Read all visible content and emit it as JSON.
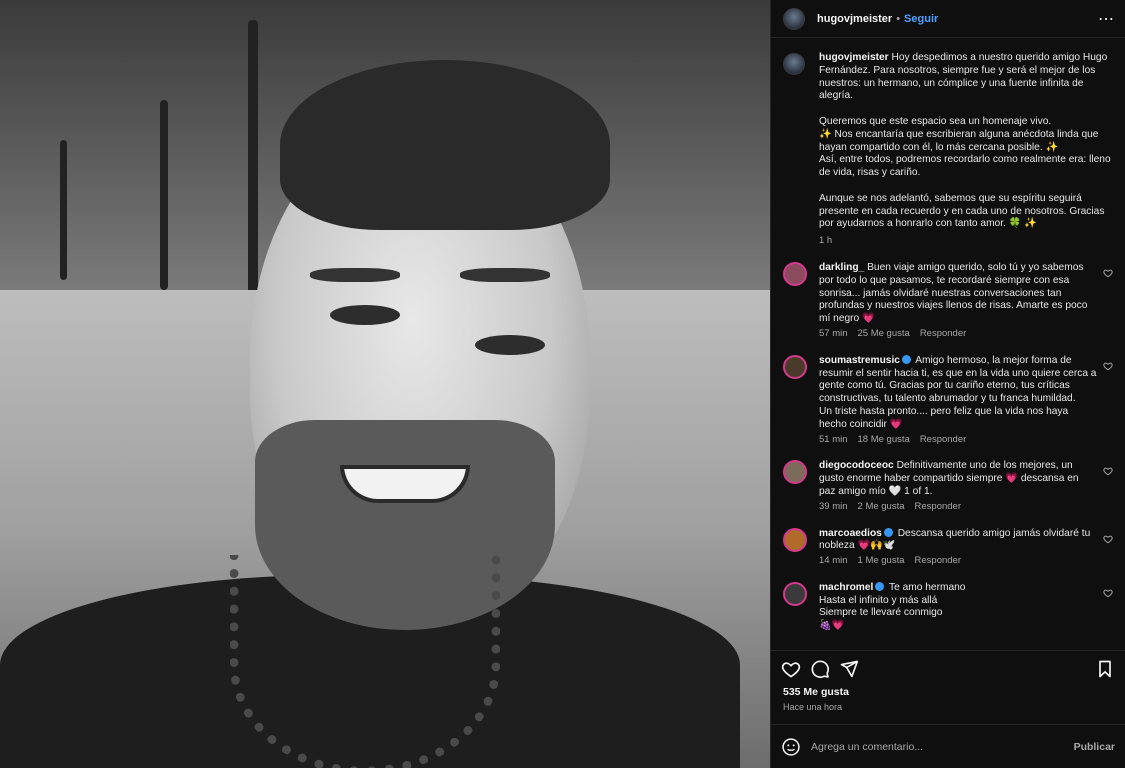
{
  "post": {
    "username": "hugovjmeister",
    "separator": "•",
    "follow_label": "Seguir",
    "more_label": "⋯"
  },
  "caption": {
    "username": "hugovjmeister",
    "paragraphs": [
      "Hoy despedimos a nuestro querido amigo Hugo Fernández. Para nosotros, siempre fue y será el mejor de los nuestros: un hermano, un cómplice y una fuente infinita de alegría.",
      "Queremos que este espacio sea un homenaje vivo.\n✨ Nos encantaría que escribieran alguna anécdota linda que hayan compartido con él, lo más cercana posible. ✨\nAsí, entre todos, podremos recordarlo como realmente era: lleno de vida, risas y cariño.",
      "Aunque se nos adelantó, sabemos que su espíritu seguirá presente en cada recuerdo y en cada uno de nosotros. Gracias por ayudarnos a honrarlo con tanto amor. 🍀 ✨"
    ],
    "time": "1 h"
  },
  "comments": [
    {
      "username": "darkling_",
      "verified": false,
      "text": "Buen viaje amigo querido, solo tú y yo sabemos por todo lo que pasamos, te recordaré siempre con esa sonrisa... jamás olvidaré nuestras conversaciones tan profundas y nuestros viajes llenos de risas. Amarte es poco mí negro 💗",
      "time": "57 min",
      "likes": "25 Me gusta",
      "reply": "Responder",
      "avatar_color": "#8a4b5e"
    },
    {
      "username": "soumastremusic",
      "verified": true,
      "text": "Amigo hermoso, la mejor forma de resumir el sentir hacia ti, es que en la vida uno quiere cerca a gente como tú. Gracias por tu cariño eterno, tus críticas constructivas, tu talento abrumador y tu franca humildad.\nUn triste hasta pronto.... pero feliz que la vida nos haya hecho coincidir 💗",
      "time": "51 min",
      "likes": "18 Me gusta",
      "reply": "Responder",
      "avatar_color": "#4a3a2a"
    },
    {
      "username": "diegocodoceoc",
      "verified": false,
      "text": "Definitivamente uno de los mejores, un gusto enorme haber compartido siempre 💗 descansa en paz amigo mío 🤍 1 of 1.",
      "time": "39 min",
      "likes": "2 Me gusta",
      "reply": "Responder",
      "avatar_color": "#7c6a5a"
    },
    {
      "username": "marcoaedios",
      "verified": true,
      "text": "Descansa querido amigo jamás olvidaré tu nobleza 💗🙌🕊️",
      "time": "14 min",
      "likes": "1 Me gusta",
      "reply": "Responder",
      "avatar_color": "#b06a2a"
    },
    {
      "username": "machromel",
      "verified": true,
      "text": "Te amo hermano\nHasta el infinito y más allá\nSiempre te llevaré conmigo\n🍇💗",
      "time": "",
      "likes": "",
      "reply": "",
      "avatar_color": "#3a3a3a"
    }
  ],
  "footer": {
    "likes": "535 Me gusta",
    "posted": "Hace una hora",
    "comment_placeholder": "Agrega un comentario...",
    "publish_label": "Publicar"
  },
  "icons": [
    "more-icon",
    "heart-icon",
    "comment-icon",
    "share-icon",
    "bookmark-icon",
    "emoji-icon",
    "verified-icon"
  ],
  "colors": {
    "accent": "#4da3ff",
    "panel_bg": "#0f0f0f",
    "muted": "#a8a8a8",
    "story_ring": "#d43a8c"
  }
}
